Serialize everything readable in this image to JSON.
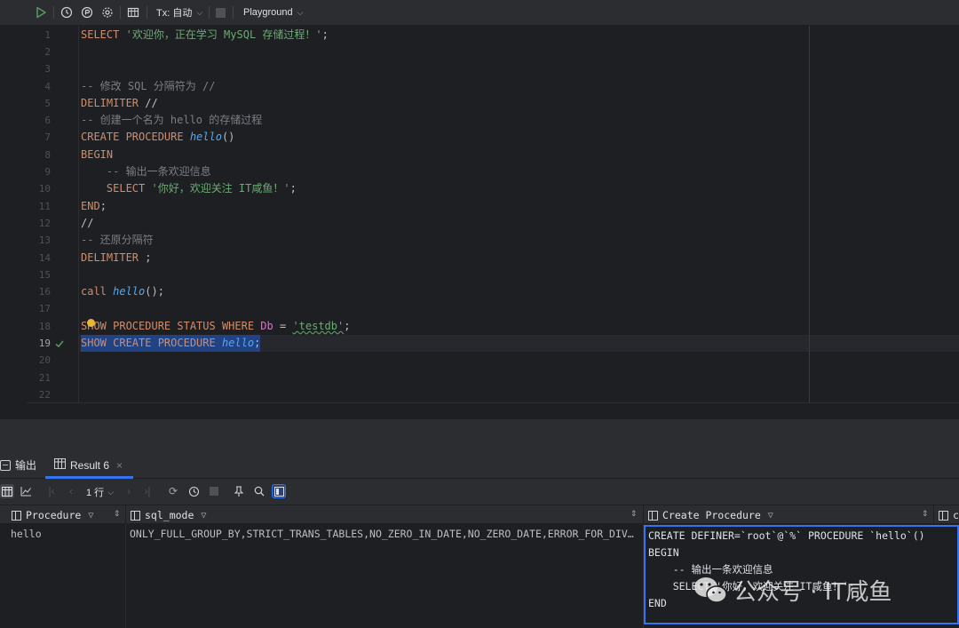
{
  "toolbar": {
    "tx_label": "Tx: 自动",
    "playground_label": "Playground"
  },
  "editor": {
    "line_numbers": [
      "1",
      "2",
      "3",
      "4",
      "5",
      "6",
      "7",
      "8",
      "9",
      "10",
      "11",
      "12",
      "13",
      "14",
      "15",
      "16",
      "17",
      "18",
      "19",
      "20",
      "21",
      "22"
    ],
    "active_line": "19",
    "lines": {
      "l1_kw": "SELECT",
      "l1_str": "'欢迎你，正在学习 MySQL 存储过程！'",
      "l1_end": ";",
      "l4": "-- 修改 SQL 分隔符为 //",
      "l5_kw": "DELIMITER",
      "l5_rest": " //",
      "l6": "-- 创建一个名为 hello 的存储过程",
      "l7_kw": "CREATE PROCEDURE ",
      "l7_fn": "hello",
      "l7_rest": "()",
      "l8": "BEGIN",
      "l9": "    -- 输出一条欢迎信息",
      "l10_kw": "    SELECT ",
      "l10_str": "'你好，欢迎关注 IT咸鱼！'",
      "l10_end": ";",
      "l11_kw": "END",
      "l11_end": ";",
      "l12": "//",
      "l13": "-- 还原分隔符",
      "l14_kw": "DELIMITER",
      "l14_rest": " ;",
      "l16_kw": "call ",
      "l16_fn": "hello",
      "l16_rest": "();",
      "l18_kw": "SHOW PROCEDURE STATUS WHERE ",
      "l18_col": "Db",
      "l18_eq": " = ",
      "l18_str": "'testdb'",
      "l18_end": ";",
      "l19_kw": "SHOW CREATE PROCEDURE ",
      "l19_fn": "hello",
      "l19_end": ";"
    }
  },
  "bottom": {
    "tab_output": "输出",
    "tab_result": "Result 6",
    "tab_close": "×",
    "rows_label": "1 行",
    "columns": [
      "Procedure",
      "sql_mode",
      "Create Procedure",
      "c"
    ],
    "row": {
      "procedure": "hello",
      "sql_mode": "ONLY_FULL_GROUP_BY,STRICT_TRANS_TABLES,NO_ZERO_IN_DATE,NO_ZERO_DATE,ERROR_FOR_DIV…",
      "create_procedure": [
        "CREATE DEFINER=`root`@`%` PROCEDURE `hello`()",
        "BEGIN",
        "    -- 输出一条欢迎信息",
        "    SELECT '你好，欢迎关注 IT咸鱼！';",
        "END"
      ]
    }
  },
  "watermark": {
    "text": "公众号 · IT咸鱼"
  }
}
